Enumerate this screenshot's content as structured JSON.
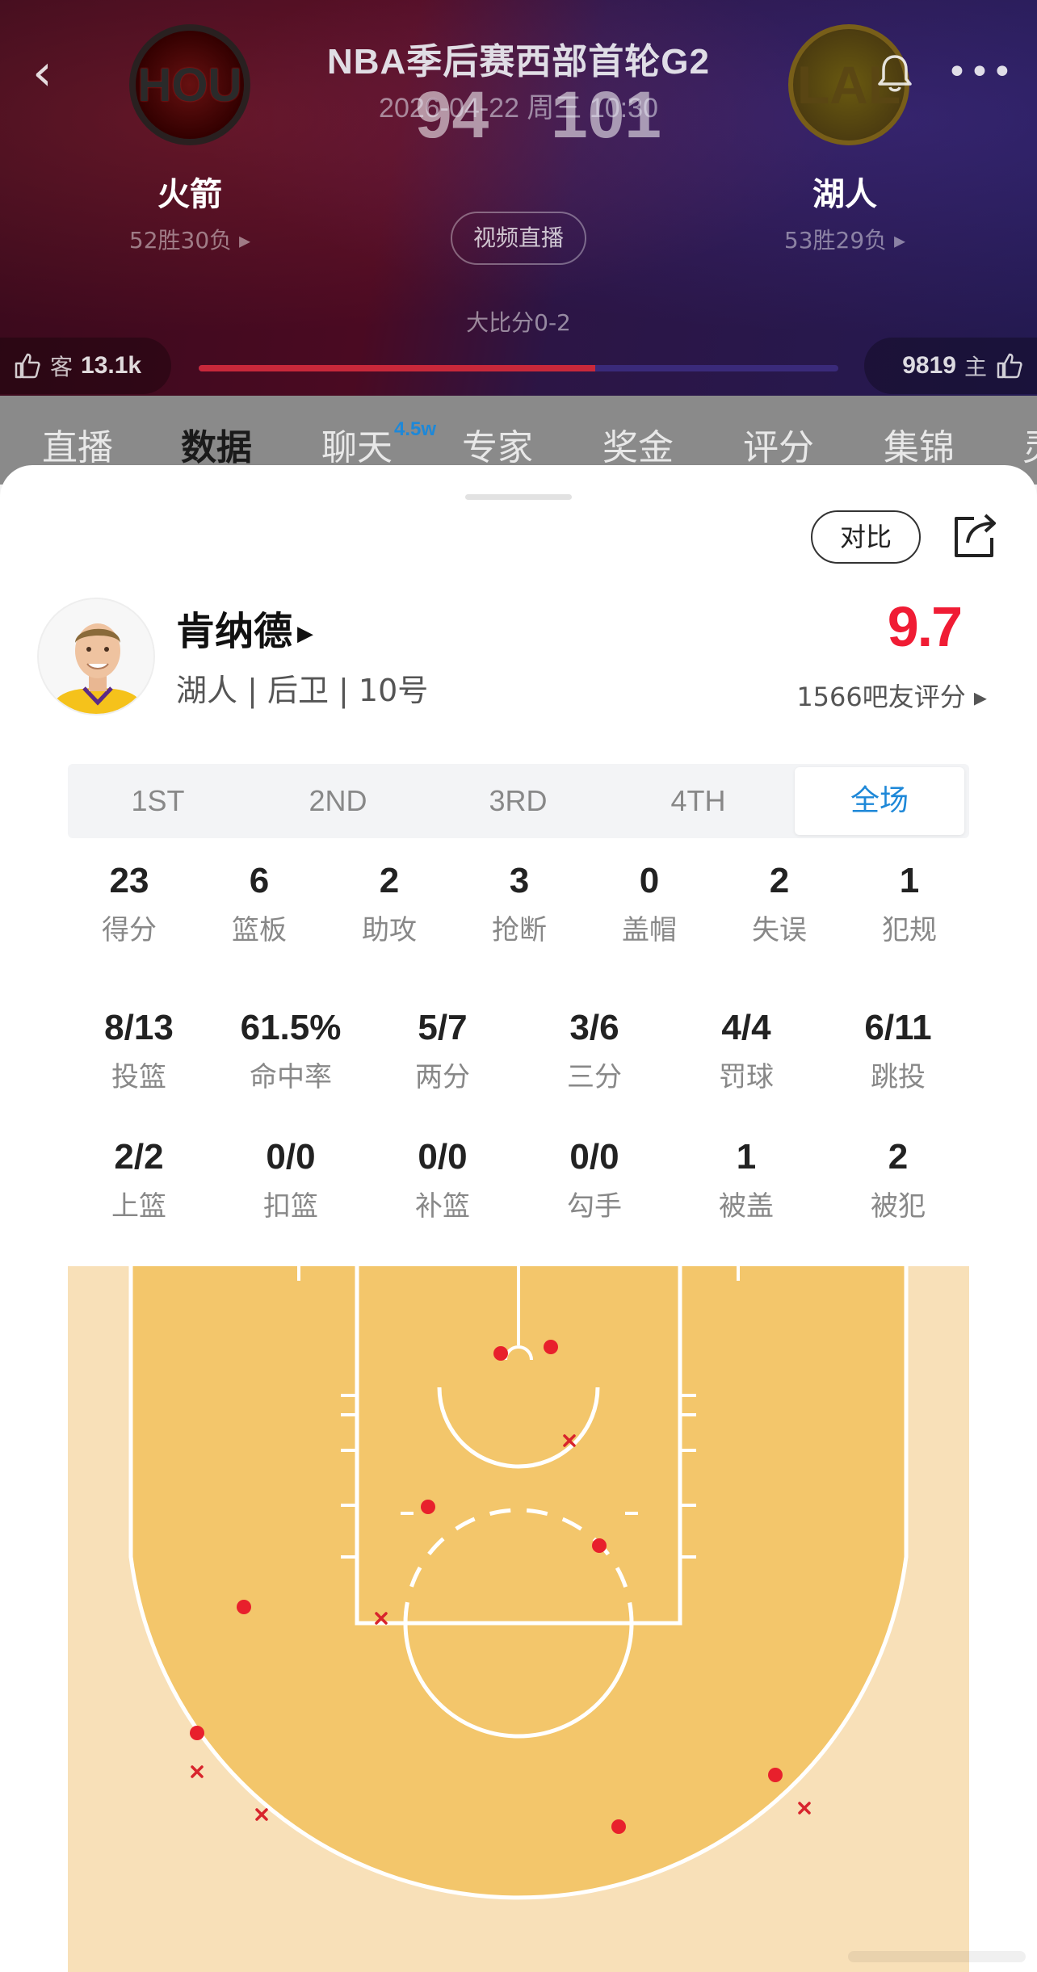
{
  "header": {
    "title": "NBA季后赛西部首轮G2",
    "datetime": "2026-04-22 周三 10:30",
    "away_team": {
      "name": "火箭",
      "abbr": "HOU",
      "record": "52胜30负 ▸",
      "score": "94",
      "likes": "13.1k",
      "like_side": "客"
    },
    "home_team": {
      "name": "湖人",
      "abbr": "LAL",
      "record": "53胜29负 ▸",
      "score": "101",
      "likes": "9819",
      "like_side": "主"
    },
    "live_button": "视频直播",
    "series": "大比分0-2",
    "vote_share_away": 0.62
  },
  "tabs": [
    {
      "label": "直播"
    },
    {
      "label": "数据",
      "active": true
    },
    {
      "label": "聊天",
      "badge": "4.5w"
    },
    {
      "label": "专家"
    },
    {
      "label": "奖金"
    },
    {
      "label": "评分"
    },
    {
      "label": "集锦"
    },
    {
      "label": "灵"
    }
  ],
  "sheet": {
    "compare_button": "对比",
    "player": {
      "name": "肯纳德",
      "meta": "湖人 | 后卫 | 10号"
    },
    "rating": "9.7",
    "rating_count": "1566吧友评分 ▸",
    "periods": [
      {
        "label": "1ST"
      },
      {
        "label": "2ND"
      },
      {
        "label": "3RD"
      },
      {
        "label": "4TH"
      },
      {
        "label": "全场",
        "active": true
      }
    ],
    "stats_row1": [
      {
        "value": "23",
        "label": "得分"
      },
      {
        "value": "6",
        "label": "篮板"
      },
      {
        "value": "2",
        "label": "助攻"
      },
      {
        "value": "3",
        "label": "抢断"
      },
      {
        "value": "0",
        "label": "盖帽"
      },
      {
        "value": "2",
        "label": "失误"
      },
      {
        "value": "1",
        "label": "犯规"
      }
    ],
    "stats_row2": [
      {
        "value": "8/13",
        "label": "投篮"
      },
      {
        "value": "61.5%",
        "label": "命中率"
      },
      {
        "value": "5/7",
        "label": "两分"
      },
      {
        "value": "3/6",
        "label": "三分"
      },
      {
        "value": "4/4",
        "label": "罚球"
      },
      {
        "value": "6/11",
        "label": "跳投"
      }
    ],
    "stats_row3": [
      {
        "value": "2/2",
        "label": "上篮"
      },
      {
        "value": "0/0",
        "label": "扣篮"
      },
      {
        "value": "0/0",
        "label": "补篮"
      },
      {
        "value": "0/0",
        "label": "勾手"
      },
      {
        "value": "1",
        "label": "被盖"
      },
      {
        "value": "2",
        "label": "被犯"
      }
    ]
  },
  "shot_chart": {
    "made_color": "#e8202c",
    "miss_color": "#d8242c",
    "shots_made": 8,
    "shots_missed": 5
  },
  "colors": {
    "accent_blue": "#1e88d8",
    "rating_red": "#f01c34",
    "court_paint": "#f3c66b",
    "court_floor": "#f8e0b8"
  }
}
